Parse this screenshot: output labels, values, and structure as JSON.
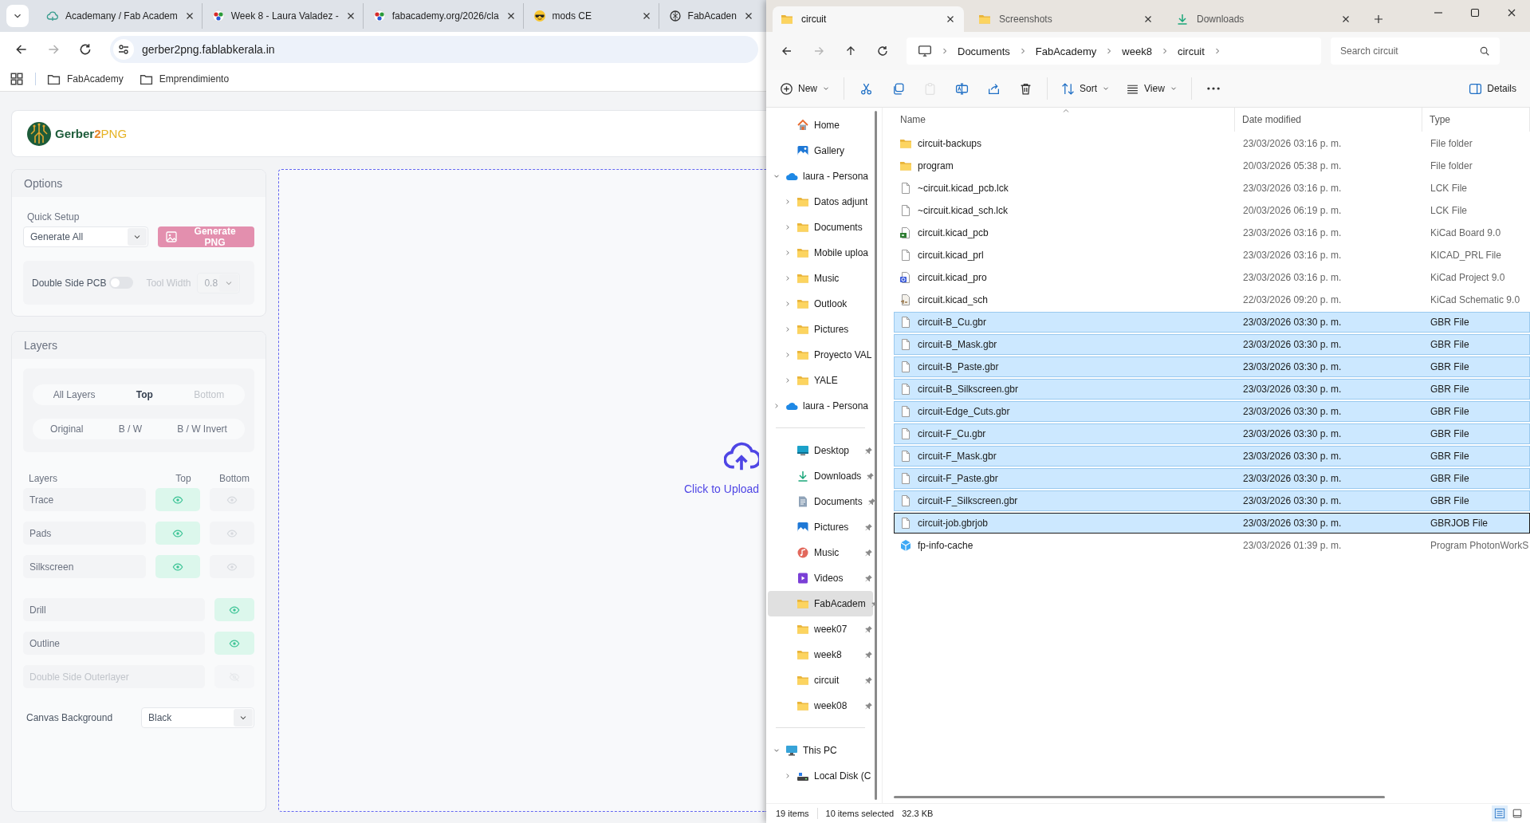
{
  "browser": {
    "tabs": [
      {
        "title": "Academany / Fab Academ",
        "kind": "cloud",
        "selected": false
      },
      {
        "title": "Week 8 - Laura Valadez -",
        "kind": "fab",
        "selected": false
      },
      {
        "title": "fabacademy.org/2026/cla",
        "kind": "fab",
        "selected": false
      },
      {
        "title": "mods CE",
        "kind": "emoji",
        "selected": false
      },
      {
        "title": "FabAcaden",
        "kind": "knot",
        "selected": false
      }
    ],
    "address": "gerber2png.fablabkerala.in",
    "bookmarks": [
      "FabAcademy",
      "Emprendimiento"
    ]
  },
  "app": {
    "logo_parts": [
      "Gerber",
      "2",
      "PNG"
    ],
    "options": {
      "title": "Options",
      "quick_setup_label": "Quick Setup",
      "quick_setup_value": "Generate All",
      "generate_button": {
        "label": "Generate PNG",
        "disabled": true
      },
      "double_side": {
        "label": "Double Side PCB",
        "on": false
      },
      "tool_width": {
        "label": "Tool Width",
        "value": "0.8",
        "disabled": true
      }
    },
    "layers": {
      "title": "Layers",
      "side_tabs": [
        {
          "label": "All Layers",
          "selected": false,
          "disabled": false
        },
        {
          "label": "Top",
          "selected": true,
          "disabled": false
        },
        {
          "label": "Bottom",
          "selected": false,
          "disabled": true
        }
      ],
      "mode_tabs": [
        {
          "label": "Original",
          "selected": false
        },
        {
          "label": "B / W",
          "selected": false
        },
        {
          "label": "B / W Invert",
          "selected": false
        }
      ],
      "columns": [
        "Layers",
        "Top",
        "Bottom"
      ],
      "sided_rows": [
        {
          "name": "Trace",
          "top": true,
          "bottom": false
        },
        {
          "name": "Pads",
          "top": true,
          "bottom": false
        },
        {
          "name": "Silkscreen",
          "top": true,
          "bottom": false
        }
      ],
      "single_rows": [
        {
          "name": "Drill",
          "visible": true,
          "disabled": false
        },
        {
          "name": "Outline",
          "visible": true,
          "disabled": false
        },
        {
          "name": "Double Side Outerlayer",
          "visible": false,
          "disabled": true
        }
      ],
      "canvas_background": {
        "label": "Canvas Background",
        "value": "Black"
      }
    },
    "upload": {
      "label": "Click to Upload"
    }
  },
  "explorer": {
    "tabs": [
      {
        "title": "circuit",
        "kind": "folder",
        "selected": true
      },
      {
        "title": "Screenshots",
        "kind": "folder",
        "selected": false
      },
      {
        "title": "Downloads",
        "kind": "download",
        "selected": false
      }
    ],
    "forward": {
      "disabled": true
    },
    "breadcrumb": [
      "Documents",
      "FabAcademy",
      "week8",
      "circuit"
    ],
    "search_placeholder": "Search circuit",
    "toolbar": [
      {
        "kind": "new",
        "label": "New",
        "disabled": false
      },
      {
        "kind": "cut",
        "disabled": false
      },
      {
        "kind": "copy",
        "disabled": false
      },
      {
        "kind": "paste",
        "disabled": true
      },
      {
        "kind": "rename",
        "disabled": false
      },
      {
        "kind": "share",
        "disabled": false
      },
      {
        "kind": "delete",
        "disabled": false
      },
      {
        "kind": "sort",
        "label": "Sort",
        "disabled": false
      },
      {
        "kind": "view",
        "label": "View",
        "disabled": false
      },
      {
        "kind": "more",
        "disabled": false
      }
    ],
    "details_label": "Details",
    "nav": {
      "quick": [
        {
          "label": "Home",
          "kind": "home",
          "selected": false
        },
        {
          "label": "Gallery",
          "kind": "gallery",
          "selected": false
        }
      ],
      "cloud": [
        {
          "label": "laura - Persona",
          "kind": "cloud",
          "selected": false,
          "expanded": true,
          "children": [
            {
              "label": "Datos adjunt",
              "kind": "folder",
              "selected": false,
              "expanded": false
            },
            {
              "label": "Documents",
              "kind": "folder",
              "selected": false,
              "expanded": false
            },
            {
              "label": "Mobile uploa",
              "kind": "folder",
              "selected": false,
              "expanded": false
            },
            {
              "label": "Music",
              "kind": "folder",
              "selected": false,
              "expanded": false
            },
            {
              "label": "Outlook",
              "kind": "folder",
              "selected": false,
              "expanded": false
            },
            {
              "label": "Pictures",
              "kind": "folder",
              "selected": false,
              "expanded": false
            },
            {
              "label": "Proyecto VAL",
              "kind": "folder",
              "selected": false,
              "expanded": false
            },
            {
              "label": "YALE",
              "kind": "folder",
              "selected": false,
              "expanded": false
            }
          ]
        },
        {
          "label": "laura - Persona",
          "kind": "cloud",
          "selected": false,
          "expanded": false
        }
      ],
      "pinned": [
        {
          "label": "Desktop",
          "kind": "desktop",
          "selected": false
        },
        {
          "label": "Downloads",
          "kind": "downloads",
          "selected": false
        },
        {
          "label": "Documents",
          "kind": "documents",
          "selected": false
        },
        {
          "label": "Pictures",
          "kind": "pictures",
          "selected": false
        },
        {
          "label": "Music",
          "kind": "music",
          "selected": false
        },
        {
          "label": "Videos",
          "kind": "videos",
          "selected": false
        },
        {
          "label": "FabAcadem",
          "kind": "folder",
          "selected": true
        },
        {
          "label": "week07",
          "kind": "folder",
          "selected": false
        },
        {
          "label": "week8",
          "kind": "folder",
          "selected": false
        },
        {
          "label": "circuit",
          "kind": "folder",
          "selected": false
        },
        {
          "label": "week08",
          "kind": "folder",
          "selected": false
        }
      ],
      "pc": [
        {
          "label": "This PC",
          "kind": "pc",
          "selected": false,
          "expanded": true,
          "children": [
            {
              "label": "Local Disk (C",
              "kind": "disk",
              "selected": false,
              "expanded": false
            }
          ]
        }
      ]
    },
    "files": {
      "columns": [
        "Name",
        "Date modified",
        "Type"
      ],
      "rows": [
        {
          "name": "circuit-backups",
          "date": "23/03/2026 03:16 p. m.",
          "type": "File folder",
          "kind": "folder",
          "selected": false,
          "focused": false
        },
        {
          "name": "program",
          "date": "20/03/2026 05:38 p. m.",
          "type": "File folder",
          "kind": "folder",
          "selected": false,
          "focused": false
        },
        {
          "name": "~circuit.kicad_pcb.lck",
          "date": "23/03/2026 03:16 p. m.",
          "type": "LCK File",
          "kind": "file",
          "selected": false,
          "focused": false
        },
        {
          "name": "~circuit.kicad_sch.lck",
          "date": "20/03/2026 06:19 p. m.",
          "type": "LCK File",
          "kind": "file",
          "selected": false,
          "focused": false
        },
        {
          "name": "circuit.kicad_pcb",
          "date": "23/03/2026 03:16 p. m.",
          "type": "KiCad Board 9.0",
          "kind": "board",
          "selected": false,
          "focused": false
        },
        {
          "name": "circuit.kicad_prl",
          "date": "23/03/2026 03:16 p. m.",
          "type": "KICAD_PRL File",
          "kind": "file",
          "selected": false,
          "focused": false
        },
        {
          "name": "circuit.kicad_pro",
          "date": "23/03/2026 03:16 p. m.",
          "type": "KiCad Project 9.0",
          "kind": "project",
          "selected": false,
          "focused": false
        },
        {
          "name": "circuit.kicad_sch",
          "date": "22/03/2026 09:20 p. m.",
          "type": "KiCad Schematic 9.0",
          "kind": "schematic",
          "selected": false,
          "focused": false
        },
        {
          "name": "circuit-B_Cu.gbr",
          "date": "23/03/2026 03:30 p. m.",
          "type": "GBR File",
          "kind": "file",
          "selected": true,
          "focused": false
        },
        {
          "name": "circuit-B_Mask.gbr",
          "date": "23/03/2026 03:30 p. m.",
          "type": "GBR File",
          "kind": "file",
          "selected": true,
          "focused": false
        },
        {
          "name": "circuit-B_Paste.gbr",
          "date": "23/03/2026 03:30 p. m.",
          "type": "GBR File",
          "kind": "file",
          "selected": true,
          "focused": false
        },
        {
          "name": "circuit-B_Silkscreen.gbr",
          "date": "23/03/2026 03:30 p. m.",
          "type": "GBR File",
          "kind": "file",
          "selected": true,
          "focused": false
        },
        {
          "name": "circuit-Edge_Cuts.gbr",
          "date": "23/03/2026 03:30 p. m.",
          "type": "GBR File",
          "kind": "file",
          "selected": true,
          "focused": false
        },
        {
          "name": "circuit-F_Cu.gbr",
          "date": "23/03/2026 03:30 p. m.",
          "type": "GBR File",
          "kind": "file",
          "selected": true,
          "focused": false
        },
        {
          "name": "circuit-F_Mask.gbr",
          "date": "23/03/2026 03:30 p. m.",
          "type": "GBR File",
          "kind": "file",
          "selected": true,
          "focused": false
        },
        {
          "name": "circuit-F_Paste.gbr",
          "date": "23/03/2026 03:30 p. m.",
          "type": "GBR File",
          "kind": "file",
          "selected": true,
          "focused": false
        },
        {
          "name": "circuit-F_Silkscreen.gbr",
          "date": "23/03/2026 03:30 p. m.",
          "type": "GBR File",
          "kind": "file",
          "selected": true,
          "focused": false
        },
        {
          "name": "circuit-job.gbrjob",
          "date": "23/03/2026 03:30 p. m.",
          "type": "GBRJOB File",
          "kind": "file",
          "selected": true,
          "focused": true
        },
        {
          "name": "fp-info-cache",
          "date": "23/03/2026 01:39 p. m.",
          "type": "Program PhotonWorkS",
          "kind": "cache",
          "selected": false,
          "focused": false
        }
      ]
    },
    "status": {
      "count": "19 items",
      "selection": "10 items selected",
      "size": "32.3 KB",
      "views": [
        {
          "kind": "details",
          "selected": true
        },
        {
          "kind": "tiles",
          "selected": false
        }
      ]
    }
  }
}
